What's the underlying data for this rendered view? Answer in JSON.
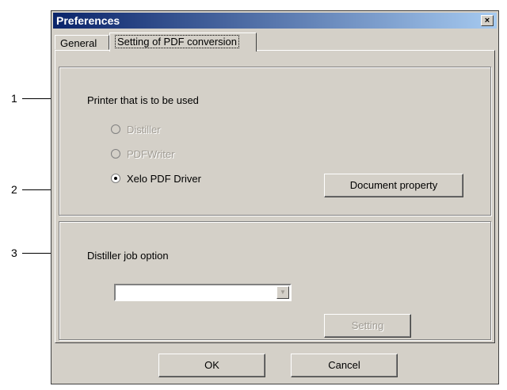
{
  "window": {
    "title": "Preferences",
    "close_glyph": "×"
  },
  "tabs": [
    {
      "label": "General"
    },
    {
      "label": "Setting of PDF conversion"
    }
  ],
  "printer_group": {
    "label": "Printer that is to be used",
    "options": [
      {
        "label": "Distiller",
        "selected": false,
        "enabled": false
      },
      {
        "label": "PDFWriter",
        "selected": false,
        "enabled": false
      },
      {
        "label": "Xelo PDF Driver",
        "selected": true,
        "enabled": true
      }
    ],
    "document_property_button": "Document property"
  },
  "distiller_group": {
    "label": "Distiller job option",
    "combo_value": "",
    "setting_button": "Setting"
  },
  "footer": {
    "ok_label": "OK",
    "cancel_label": "Cancel"
  },
  "callouts": [
    "1",
    "2",
    "3"
  ],
  "colors": {
    "titlebar_start": "#0a246a",
    "titlebar_end": "#a6caf0",
    "dialog_bg": "#d4d0c8"
  }
}
